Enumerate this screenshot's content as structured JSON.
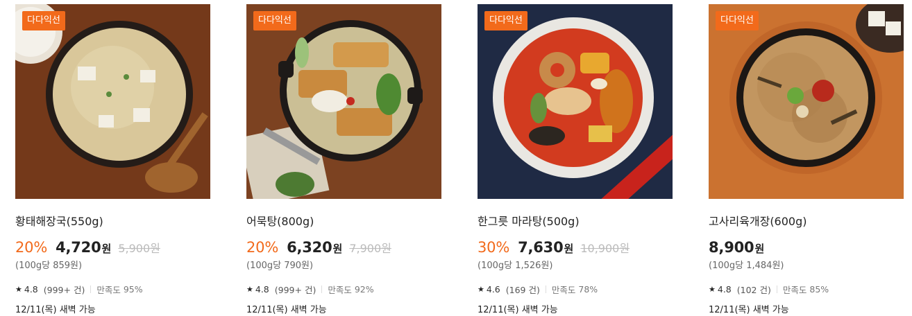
{
  "products": [
    {
      "badge": "다다익선",
      "name": "황태해장국(550g)",
      "discount": "20%",
      "sale_price": "4,720",
      "currency": "원",
      "original_price": "5,900원",
      "unit_price": "(100g당 859원)",
      "rating": "4.8",
      "reviews": "(999+ 건)",
      "satisfaction_label": "만족도",
      "satisfaction": "95%",
      "delivery": "12/11(목) 새벽 가능"
    },
    {
      "badge": "다다익선",
      "name": "어묵탕(800g)",
      "discount": "20%",
      "sale_price": "6,320",
      "currency": "원",
      "original_price": "7,900원",
      "unit_price": "(100g당 790원)",
      "rating": "4.8",
      "reviews": "(999+ 건)",
      "satisfaction_label": "만족도",
      "satisfaction": "92%",
      "delivery": "12/11(목) 새벽 가능"
    },
    {
      "badge": "다다익선",
      "name": "한그릇 마라탕(500g)",
      "discount": "30%",
      "sale_price": "7,630",
      "currency": "원",
      "original_price": "10,900원",
      "unit_price": "(100g당 1,526원)",
      "rating": "4.6",
      "reviews": "(169 건)",
      "satisfaction_label": "만족도",
      "satisfaction": "78%",
      "delivery": "12/11(목) 새벽 가능"
    },
    {
      "badge": "다다익선",
      "name": "고사리육개장(600g)",
      "discount": "",
      "sale_price": "8,900",
      "currency": "원",
      "original_price": "",
      "unit_price": "(100g당 1,484원)",
      "rating": "4.8",
      "reviews": "(102 건)",
      "satisfaction_label": "만족도",
      "satisfaction": "85%",
      "delivery": "12/11(목) 새벽 가능"
    }
  ],
  "icons": {
    "rating": "star-icon"
  },
  "colors": {
    "accent": "#f26a1b",
    "strikethrough": "#bbbbbb"
  }
}
